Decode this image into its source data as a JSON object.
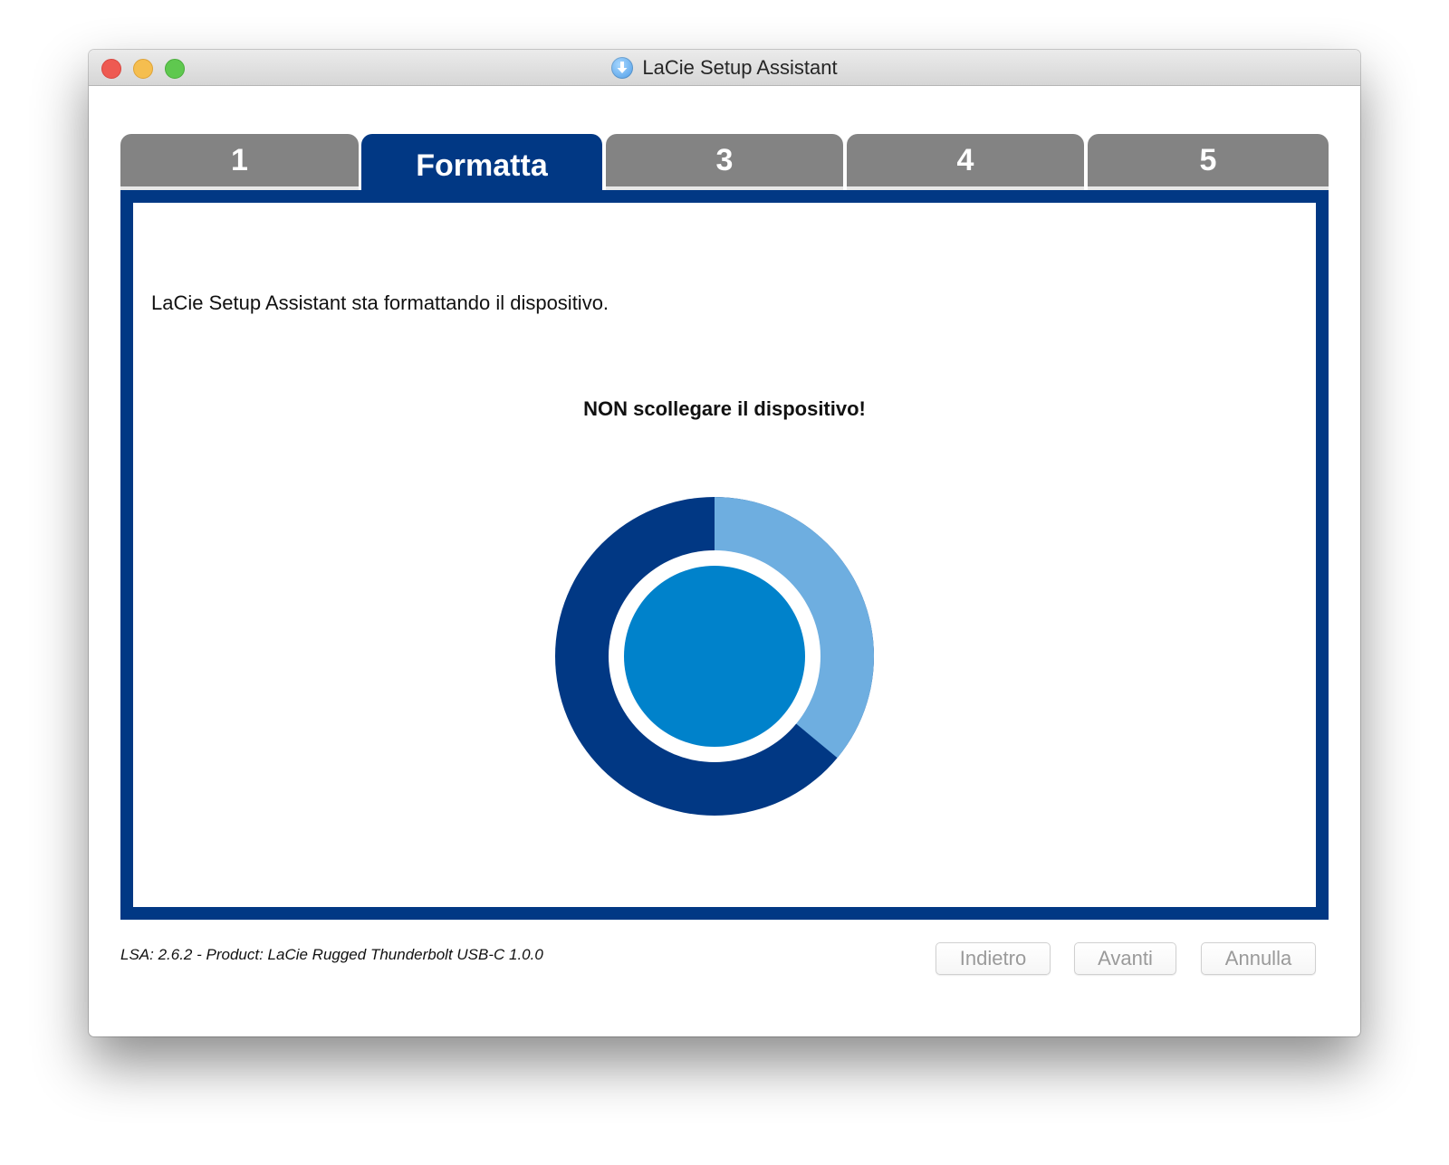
{
  "window": {
    "title": "LaCie Setup Assistant",
    "app_icon": "download-arrow-icon"
  },
  "tabs": [
    {
      "label": "1",
      "active": false
    },
    {
      "label": "Formatta",
      "active": true
    },
    {
      "label": "3",
      "active": false
    },
    {
      "label": "4",
      "active": false
    },
    {
      "label": "5",
      "active": false
    }
  ],
  "main": {
    "message": "LaCie Setup Assistant sta formattando il dispositivo.",
    "warning": "NON scollegare il dispositivo!",
    "progress": {
      "fraction_complete": 0.36,
      "colors": {
        "complete": "#6eaee0",
        "remaining": "#013884",
        "center": "#0082cb"
      }
    }
  },
  "footer": {
    "version_text": "LSA: 2.6.2 - Product: LaCie Rugged Thunderbolt USB-C 1.0.0",
    "buttons": {
      "back": "Indietro",
      "next": "Avanti",
      "cancel": "Annulla"
    }
  },
  "colors": {
    "brand_blue": "#013884",
    "tab_inactive": "#838383"
  }
}
